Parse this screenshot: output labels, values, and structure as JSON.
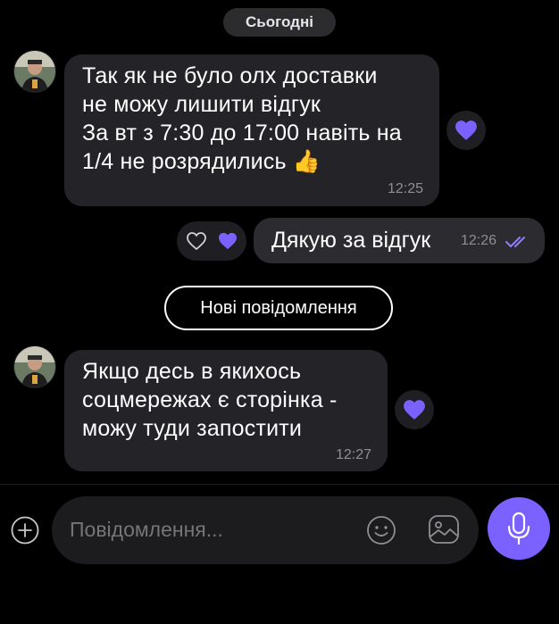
{
  "date_divider": "Сьогодні",
  "messages": [
    {
      "direction": "incoming",
      "text": "Так як не було олх доставки\nне можу лишити відгук\nЗа вт з 7:30 до 17:00 навіть на\n1/4 не розрядились 👍",
      "time": "12:25",
      "reaction": "heart"
    },
    {
      "direction": "outgoing",
      "text": "Дякую за відгук",
      "time": "12:26",
      "status": "read"
    },
    {
      "direction": "incoming",
      "text": "Якщо десь в якихось\nсоцмережах є сторінка -\nможу туди запостити",
      "time": "12:27",
      "reaction": "heart"
    }
  ],
  "new_messages_label": "Нові повідомлення",
  "composer": {
    "placeholder": "Повідомлення..."
  },
  "icons": {
    "add": "plus-circle-icon",
    "emoji": "smiley-icon",
    "gallery": "image-icon",
    "mic": "microphone-icon",
    "reaction": "heart-icon",
    "read": "double-check-icon"
  },
  "colors": {
    "accent": "#7b61ff",
    "heart": "#7b61ff",
    "bubble_incoming": "#242428",
    "bubble_outgoing": "#2c2c30",
    "background": "#000000"
  }
}
